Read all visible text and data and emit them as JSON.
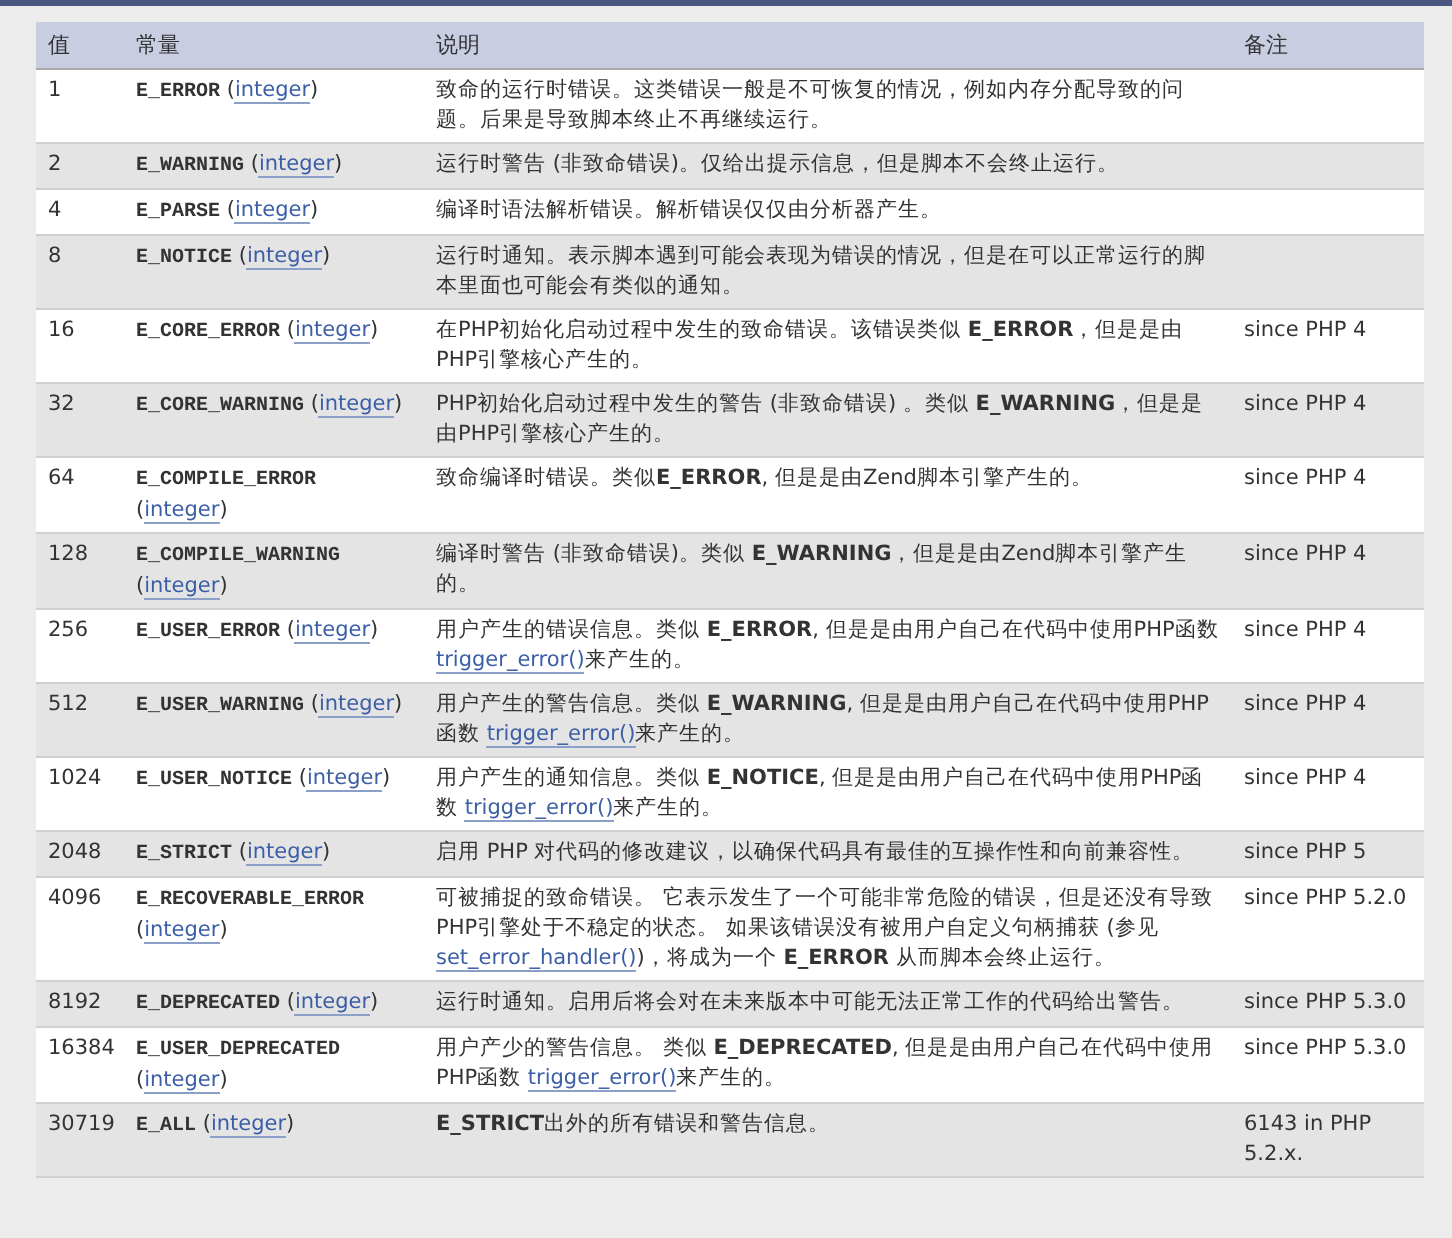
{
  "table": {
    "columns": [
      "值",
      "常量",
      "说明",
      "备注"
    ],
    "rows": [
      {
        "value": "1",
        "constant": [
          {
            "kind": "code",
            "text": "E_ERROR"
          },
          {
            "kind": "text",
            "text": " ("
          },
          {
            "kind": "link",
            "text": "integer"
          },
          {
            "kind": "text",
            "text": ")"
          }
        ],
        "description": [
          {
            "kind": "text",
            "text": "致命的运行时错误。这类错误一般是不可恢复的情况，例如内存分配导致的问题。后果是导致脚本终止不再继续运行。"
          }
        ],
        "note": ""
      },
      {
        "value": "2",
        "constant": [
          {
            "kind": "code",
            "text": "E_WARNING"
          },
          {
            "kind": "text",
            "text": " ("
          },
          {
            "kind": "link",
            "text": "integer"
          },
          {
            "kind": "text",
            "text": ")"
          }
        ],
        "description": [
          {
            "kind": "text",
            "text": "运行时警告 (非致命错误)。仅给出提示信息，但是脚本不会终止运行。"
          }
        ],
        "note": ""
      },
      {
        "value": "4",
        "constant": [
          {
            "kind": "code",
            "text": "E_PARSE"
          },
          {
            "kind": "text",
            "text": " ("
          },
          {
            "kind": "link",
            "text": "integer"
          },
          {
            "kind": "text",
            "text": ")"
          }
        ],
        "description": [
          {
            "kind": "text",
            "text": "编译时语法解析错误。解析错误仅仅由分析器产生。"
          }
        ],
        "note": ""
      },
      {
        "value": "8",
        "constant": [
          {
            "kind": "code",
            "text": "E_NOTICE"
          },
          {
            "kind": "text",
            "text": " ("
          },
          {
            "kind": "link",
            "text": "integer"
          },
          {
            "kind": "text",
            "text": ")"
          }
        ],
        "description": [
          {
            "kind": "text",
            "text": "运行时通知。表示脚本遇到可能会表现为错误的情况，但是在可以正常运行的脚本里面也可能会有类似的通知。"
          }
        ],
        "note": ""
      },
      {
        "value": "16",
        "constant": [
          {
            "kind": "code",
            "text": "E_CORE_ERROR"
          },
          {
            "kind": "text",
            "text": " ("
          },
          {
            "kind": "link",
            "text": "integer"
          },
          {
            "kind": "text",
            "text": ")"
          }
        ],
        "description": [
          {
            "kind": "text",
            "text": "在PHP初始化启动过程中发生的致命错误。该错误类似 **E_ERROR**，但是是由PHP引擎核心产生的。"
          }
        ],
        "note": "since PHP 4"
      },
      {
        "value": "32",
        "constant": [
          {
            "kind": "code",
            "text": "E_CORE_WARNING"
          },
          {
            "kind": "text",
            "text": " ("
          },
          {
            "kind": "link",
            "text": "integer"
          },
          {
            "kind": "text",
            "text": ")"
          }
        ],
        "description": [
          {
            "kind": "text",
            "text": "PHP初始化启动过程中发生的警告 (非致命错误) 。类似 **E_WARNING**，但是是由PHP引擎核心产生的。"
          }
        ],
        "note": "since PHP 4"
      },
      {
        "value": "64",
        "constant": [
          {
            "kind": "code",
            "text": "E_COMPILE_ERROR"
          },
          {
            "kind": "text",
            "text": " ("
          },
          {
            "kind": "link",
            "text": "integer"
          },
          {
            "kind": "text",
            "text": ")"
          }
        ],
        "description": [
          {
            "kind": "text",
            "text": "致命编译时错误。类似**E_ERROR**, 但是是由Zend脚本引擎产生的。"
          }
        ],
        "note": "since PHP 4"
      },
      {
        "value": "128",
        "constant": [
          {
            "kind": "code",
            "text": "E_COMPILE_WARNING"
          },
          {
            "kind": "text",
            "text": " ("
          },
          {
            "kind": "link",
            "text": "integer"
          },
          {
            "kind": "text",
            "text": ")"
          }
        ],
        "description": [
          {
            "kind": "text",
            "text": "编译时警告 (非致命错误)。类似 **E_WARNING**，但是是由Zend脚本引擎产生的。"
          }
        ],
        "note": "since PHP 4"
      },
      {
        "value": "256",
        "constant": [
          {
            "kind": "code",
            "text": "E_USER_ERROR"
          },
          {
            "kind": "text",
            "text": " ("
          },
          {
            "kind": "link",
            "text": "integer"
          },
          {
            "kind": "text",
            "text": ")"
          }
        ],
        "description": [
          {
            "kind": "text",
            "text": "用户产生的错误信息。类似 **E_ERROR**, 但是是由用户自己在代码中使用PHP函数 "
          },
          {
            "kind": "link",
            "text": "trigger_error()"
          },
          {
            "kind": "text",
            "text": "来产生的。"
          }
        ],
        "note": "since PHP 4"
      },
      {
        "value": "512",
        "constant": [
          {
            "kind": "code",
            "text": "E_USER_WARNING"
          },
          {
            "kind": "text",
            "text": " ("
          },
          {
            "kind": "link",
            "text": "integer"
          },
          {
            "kind": "text",
            "text": ")"
          }
        ],
        "description": [
          {
            "kind": "text",
            "text": "用户产生的警告信息。类似 **E_WARNING**, 但是是由用户自己在代码中使用PHP函数 "
          },
          {
            "kind": "link",
            "text": "trigger_error()"
          },
          {
            "kind": "text",
            "text": "来产生的。"
          }
        ],
        "note": "since PHP 4"
      },
      {
        "value": "1024",
        "constant": [
          {
            "kind": "code",
            "text": "E_USER_NOTICE"
          },
          {
            "kind": "text",
            "text": " ("
          },
          {
            "kind": "link",
            "text": "integer"
          },
          {
            "kind": "text",
            "text": ")"
          }
        ],
        "description": [
          {
            "kind": "text",
            "text": "用户产生的通知信息。类似 **E_NOTICE**, 但是是由用户自己在代码中使用PHP函数 "
          },
          {
            "kind": "link",
            "text": "trigger_error()"
          },
          {
            "kind": "text",
            "text": "来产生的。"
          }
        ],
        "note": "since PHP 4"
      },
      {
        "value": "2048",
        "constant": [
          {
            "kind": "code",
            "text": "E_STRICT"
          },
          {
            "kind": "text",
            "text": " ("
          },
          {
            "kind": "link",
            "text": "integer"
          },
          {
            "kind": "text",
            "text": ")"
          }
        ],
        "description": [
          {
            "kind": "text",
            "text": "启用 PHP 对代码的修改建议，以确保代码具有最佳的互操作性和向前兼容性。"
          }
        ],
        "note": "since PHP 5"
      },
      {
        "value": "4096",
        "constant": [
          {
            "kind": "code",
            "text": "E_RECOVERABLE_ERROR"
          },
          {
            "kind": "text",
            "text": " ("
          },
          {
            "kind": "link",
            "text": "integer"
          },
          {
            "kind": "text",
            "text": ")"
          }
        ],
        "description": [
          {
            "kind": "text",
            "text": "可被捕捉的致命错误。 它表示发生了一个可能非常危险的错误，但是还没有导致PHP引擎处于不稳定的状态。 如果该错误没有被用户自定义句柄捕获 (参见 "
          },
          {
            "kind": "link",
            "text": "set_error_handler()"
          },
          {
            "kind": "text",
            "text": ")，将成为一个 **E_ERROR** 从而脚本会终止运行。"
          }
        ],
        "note": "since PHP 5.2.0"
      },
      {
        "value": "8192",
        "constant": [
          {
            "kind": "code",
            "text": "E_DEPRECATED"
          },
          {
            "kind": "text",
            "text": " ("
          },
          {
            "kind": "link",
            "text": "integer"
          },
          {
            "kind": "text",
            "text": ")"
          }
        ],
        "description": [
          {
            "kind": "text",
            "text": "运行时通知。启用后将会对在未来版本中可能无法正常工作的代码给出警告。"
          }
        ],
        "note": "since PHP 5.3.0"
      },
      {
        "value": "16384",
        "constant": [
          {
            "kind": "code",
            "text": "E_USER_DEPRECATED"
          },
          {
            "kind": "text",
            "text": " ("
          },
          {
            "kind": "link",
            "text": "integer"
          },
          {
            "kind": "text",
            "text": ")"
          }
        ],
        "description": [
          {
            "kind": "text",
            "text": "用户产少的警告信息。 类似 **E_DEPRECATED**, 但是是由用户自己在代码中使用PHP函数 "
          },
          {
            "kind": "link",
            "text": "trigger_error()"
          },
          {
            "kind": "text",
            "text": "来产生的。"
          }
        ],
        "note": "since PHP 5.3.0"
      },
      {
        "value": "30719",
        "constant": [
          {
            "kind": "code",
            "text": "E_ALL"
          },
          {
            "kind": "text",
            "text": " ("
          },
          {
            "kind": "link",
            "text": "integer"
          },
          {
            "kind": "text",
            "text": ")"
          }
        ],
        "description": [
          {
            "kind": "text",
            "text": "**E_STRICT**出外的所有错误和警告信息。"
          }
        ],
        "note": "6143 in PHP 5.2.x."
      }
    ]
  }
}
